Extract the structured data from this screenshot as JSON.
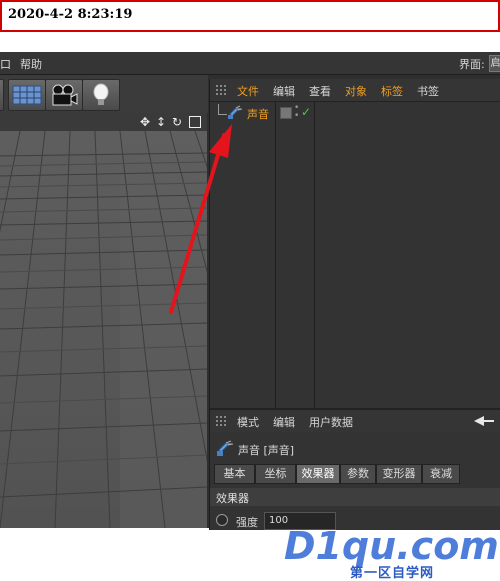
{
  "timestamp": "2020-4-2 8:23:19",
  "menubar": {
    "partial_item": "口",
    "help": "帮助",
    "layout_label": "界面:",
    "layout_value": "启"
  },
  "object_manager": {
    "menu": [
      "文件",
      "编辑",
      "查看",
      "对象",
      "标签",
      "书签"
    ],
    "objects": [
      {
        "name": "声音"
      }
    ]
  },
  "attribute_manager": {
    "menu": [
      "模式",
      "编辑",
      "用户数据"
    ],
    "object_title": "声音 [声音]",
    "tabs": [
      "基本",
      "坐标",
      "效果器",
      "参数",
      "变形器",
      "衰减"
    ],
    "active_tab": "效果器",
    "section_title": "效果器",
    "strength_label": "强度",
    "strength_value": "100"
  },
  "watermark": {
    "logo": "D1qu.com",
    "tagline": "第一区自学网"
  },
  "colors": {
    "accent_orange": "#f0a020",
    "arrow_red": "#e3141c",
    "frame_red": "#d40000"
  }
}
